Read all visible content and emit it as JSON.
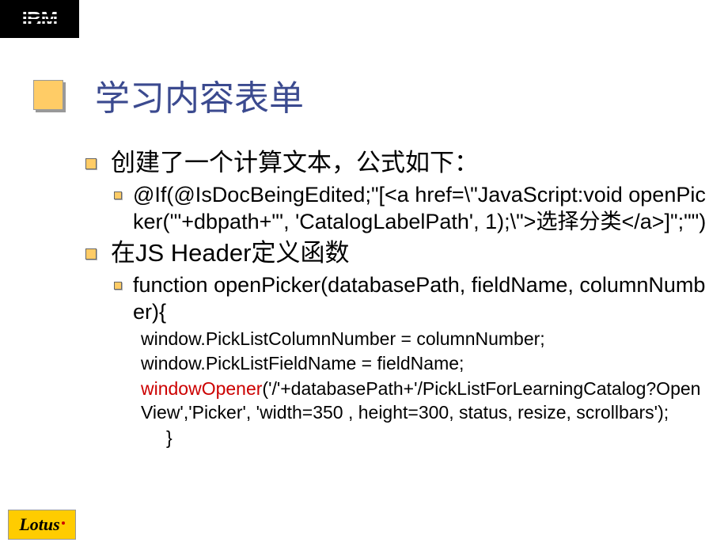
{
  "logos": {
    "ibm": "IBM",
    "lotus": "Lotus"
  },
  "title": "学习内容表单",
  "bullets": {
    "b1": "创建了一个计算文本，公式如下：",
    "b1a": "@If(@IsDocBeingEdited;\"[<a href=\\\"JavaScript:void openPicker('\"+dbpath+\"', 'CatalogLabelPath', 1);\\\">选择分类</a>]\";\"\")",
    "b2": "在JS Header定义函数",
    "b2a": "function openPicker(databasePath, fieldName, columnNumber){",
    "b2a_l1": "window.PickListColumnNumber = columnNumber;",
    "b2a_l2": "window.PickListFieldName = fieldName;",
    "b2a_l3_red": "windowOpener",
    "b2a_l3_rest": "('/'+databasePath+'/PickListForLearningCatalog?OpenView','Picker', 'width=350 , height=300, status, resize, scrollbars');",
    "b2a_brace": "}"
  }
}
